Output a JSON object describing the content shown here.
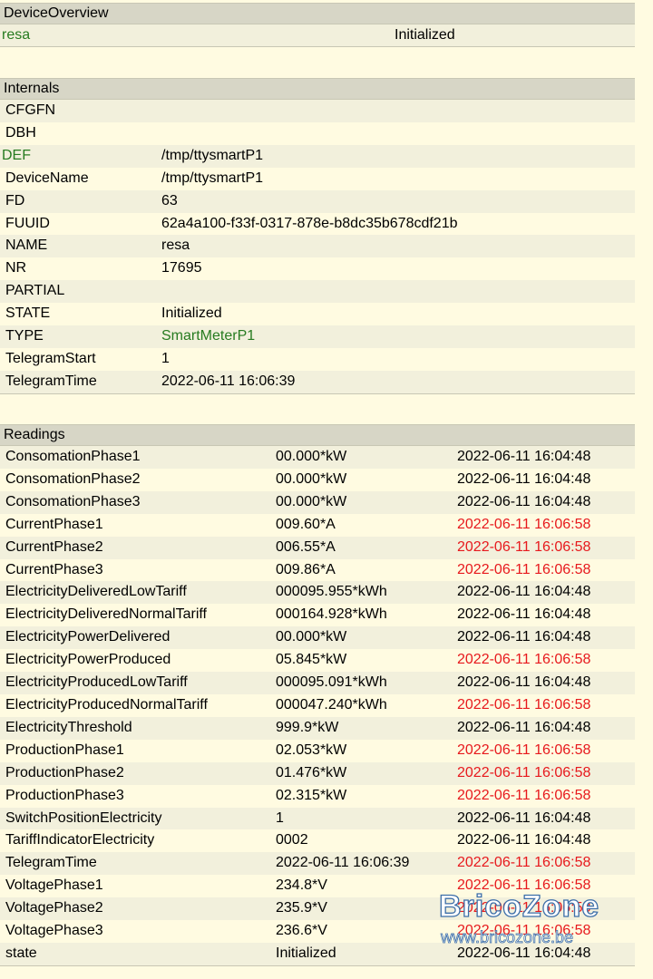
{
  "device_overview": {
    "title": "DeviceOverview",
    "name": "resa",
    "state": "Initialized"
  },
  "internals": {
    "title": "Internals",
    "rows": [
      {
        "key": "CFGFN",
        "value": ""
      },
      {
        "key": "DBH",
        "value": ""
      },
      {
        "key": "DEF",
        "value": "/tmp/ttysmartP1"
      },
      {
        "key": "DeviceName",
        "value": "/tmp/ttysmartP1"
      },
      {
        "key": "FD",
        "value": "63"
      },
      {
        "key": "FUUID",
        "value": "62a4a100-f33f-0317-878e-b8dc35b678cdf21b"
      },
      {
        "key": "NAME",
        "value": "resa"
      },
      {
        "key": "NR",
        "value": "17695"
      },
      {
        "key": "PARTIAL",
        "value": ""
      },
      {
        "key": "STATE",
        "value": "Initialized"
      },
      {
        "key": "TYPE",
        "value": "SmartMeterP1"
      },
      {
        "key": "TelegramStart",
        "value": "1"
      },
      {
        "key": "TelegramTime",
        "value": "2022-06-11 16:06:39"
      }
    ]
  },
  "readings": {
    "title": "Readings",
    "rows": [
      {
        "name": "ConsomationPhase1",
        "value": "00.000*kW",
        "time": "2022-06-11 16:04:48",
        "recent": false
      },
      {
        "name": "ConsomationPhase2",
        "value": "00.000*kW",
        "time": "2022-06-11 16:04:48",
        "recent": false
      },
      {
        "name": "ConsomationPhase3",
        "value": "00.000*kW",
        "time": "2022-06-11 16:04:48",
        "recent": false
      },
      {
        "name": "CurrentPhase1",
        "value": "009.60*A",
        "time": "2022-06-11 16:06:58",
        "recent": true
      },
      {
        "name": "CurrentPhase2",
        "value": "006.55*A",
        "time": "2022-06-11 16:06:58",
        "recent": true
      },
      {
        "name": "CurrentPhase3",
        "value": "009.86*A",
        "time": "2022-06-11 16:06:58",
        "recent": true
      },
      {
        "name": "ElectricityDeliveredLowTariff",
        "value": "000095.955*kWh",
        "time": "2022-06-11 16:04:48",
        "recent": false
      },
      {
        "name": "ElectricityDeliveredNormalTariff",
        "value": "000164.928*kWh",
        "time": "2022-06-11 16:04:48",
        "recent": false
      },
      {
        "name": "ElectricityPowerDelivered",
        "value": "00.000*kW",
        "time": "2022-06-11 16:04:48",
        "recent": false
      },
      {
        "name": "ElectricityPowerProduced",
        "value": "05.845*kW",
        "time": "2022-06-11 16:06:58",
        "recent": true
      },
      {
        "name": "ElectricityProducedLowTariff",
        "value": "000095.091*kWh",
        "time": "2022-06-11 16:04:48",
        "recent": false
      },
      {
        "name": "ElectricityProducedNormalTariff",
        "value": "000047.240*kWh",
        "time": "2022-06-11 16:06:58",
        "recent": true
      },
      {
        "name": "ElectricityThreshold",
        "value": "999.9*kW",
        "time": "2022-06-11 16:04:48",
        "recent": false
      },
      {
        "name": "ProductionPhase1",
        "value": "02.053*kW",
        "time": "2022-06-11 16:06:58",
        "recent": true
      },
      {
        "name": "ProductionPhase2",
        "value": "01.476*kW",
        "time": "2022-06-11 16:06:58",
        "recent": true
      },
      {
        "name": "ProductionPhase3",
        "value": "02.315*kW",
        "time": "2022-06-11 16:06:58",
        "recent": true
      },
      {
        "name": "SwitchPositionElectricity",
        "value": "1",
        "time": "2022-06-11 16:04:48",
        "recent": false
      },
      {
        "name": "TariffIndicatorElectricity",
        "value": "0002",
        "time": "2022-06-11 16:04:48",
        "recent": false
      },
      {
        "name": "TelegramTime",
        "value": "2022-06-11 16:06:39",
        "time": "2022-06-11 16:06:58",
        "recent": true
      },
      {
        "name": "VoltagePhase1",
        "value": "234.8*V",
        "time": "2022-06-11 16:06:58",
        "recent": true
      },
      {
        "name": "VoltagePhase2",
        "value": "235.9*V",
        "time": "2022-06-11 16:06:58",
        "recent": true
      },
      {
        "name": "VoltagePhase3",
        "value": "236.6*V",
        "time": "2022-06-11 16:06:58",
        "recent": true
      },
      {
        "name": "state",
        "value": "Initialized",
        "time": "2022-06-11 16:04:48",
        "recent": false
      }
    ]
  },
  "watermark": {
    "brand": "BricoZone",
    "url": "www.bricozone.be"
  },
  "colors": {
    "link_green": "#277b20",
    "recent_red": "#e7191d",
    "background": "#fffbe1",
    "header": "#d7d6c6",
    "row_alt": "#f2f0dc"
  }
}
